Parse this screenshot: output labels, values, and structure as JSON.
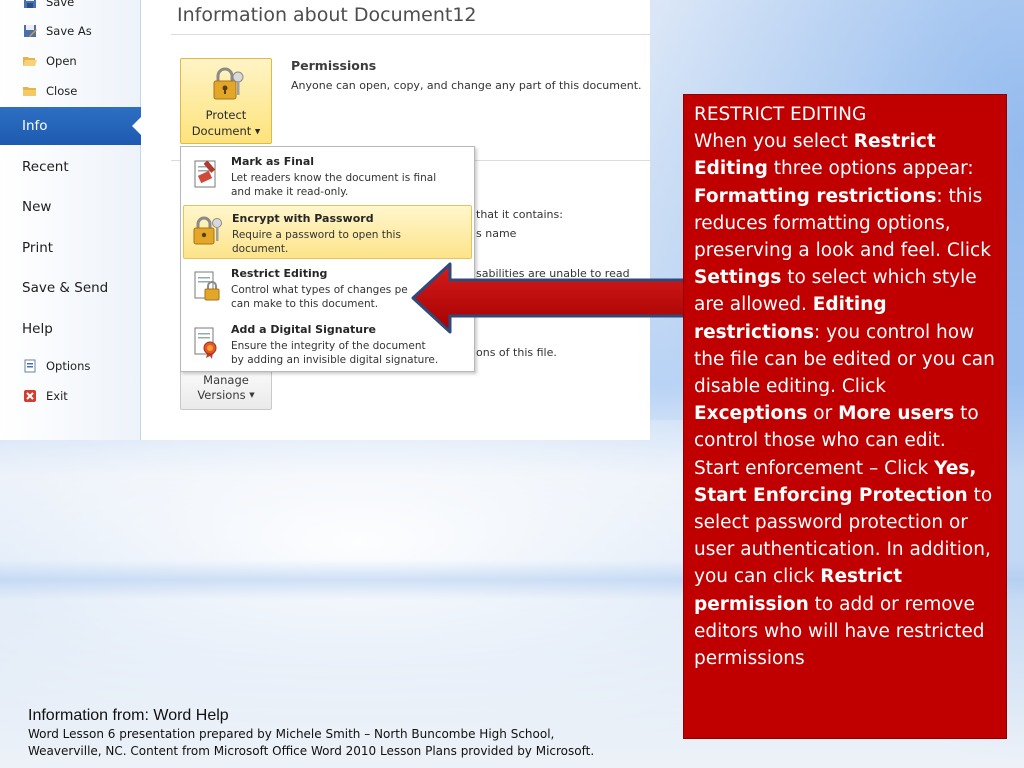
{
  "backstage": {
    "nav_small_top": [
      {
        "label": "Save",
        "icon": "save-icon"
      },
      {
        "label": "Save As",
        "icon": "save-as-icon"
      },
      {
        "label": "Open",
        "icon": "open-folder-icon"
      },
      {
        "label": "Close",
        "icon": "close-folder-icon"
      }
    ],
    "nav_selected": "Info",
    "nav_big": [
      "Recent",
      "New",
      "Print",
      "Save & Send",
      "Help"
    ],
    "nav_small_bottom": [
      {
        "label": "Options",
        "icon": "options-icon"
      },
      {
        "label": "Exit",
        "icon": "exit-icon"
      }
    ]
  },
  "info": {
    "title": "Information about Document12",
    "protect_label_1": "Protect",
    "protect_label_2": "Document",
    "permissions_heading": "Permissions",
    "permissions_text": "Anyone can open, copy, and change any part of this document.",
    "bg_line_1": "that it contains:",
    "bg_line_2": "s name",
    "bg_line_3": "sabilities are unable to read",
    "bg_line_4": "ons of this file.",
    "manage_label_1": "Manage",
    "manage_label_2": "Versions"
  },
  "protect_menu": [
    {
      "title": "Mark as Final",
      "desc_1": "Let readers know the document is final",
      "desc_2": "and make it read-only.",
      "icon": "mark-final-icon"
    },
    {
      "title": "Encrypt with Password",
      "desc_1": "Require a password to open this",
      "desc_2": "document.",
      "icon": "encrypt-lock-icon"
    },
    {
      "title": "Restrict Editing",
      "desc_1": "Control what types of changes pe",
      "desc_2": "can make to this document.",
      "icon": "restrict-editing-icon"
    },
    {
      "title": "Add a Digital Signature",
      "desc_1": "Ensure the integrity of the document",
      "desc_2": "by adding an invisible digital signature.",
      "icon": "digital-signature-icon"
    }
  ],
  "callout": {
    "heading": "RESTRICT EDITING",
    "p1_a": "When you select ",
    "p1_b": "Restrict Editing",
    "p1_c": " three options appear: ",
    "p2_a": "Formatting restrictions",
    "p2_b": ": this reduces formatting options, preserving a look and feel. Click ",
    "p2_c": "Settings",
    "p2_d": " to select which style are allowed. ",
    "p3_a": "Editing restrictions",
    "p3_b": ": you control how the file can be edited or you can disable editing. Click ",
    "p3_c": "Exceptions",
    "p3_d": " or ",
    "p3_e": "More users",
    "p3_f": " to control those who can edit. Start enforcement – Click ",
    "p3_g": "Yes, Start Enforcing Protection",
    "p3_h": " to select password protection or user authentication. In addition, you can click ",
    "p3_i": "Restrict permission",
    "p3_j": " to add or remove editors who will have restricted permissions"
  },
  "credits": {
    "heading": "Information from:  Word Help",
    "line_1": "Word Lesson 6 presentation prepared by Michele Smith – North Buncombe High School,",
    "line_2": "Weaverville, NC. Content from Microsoft Office Word 2010 Lesson Plans provided by Microsoft."
  },
  "colors": {
    "callout_bg": "#c00000",
    "nav_selected_bg": "#1d5ab0",
    "highlight": "#fde48a"
  }
}
